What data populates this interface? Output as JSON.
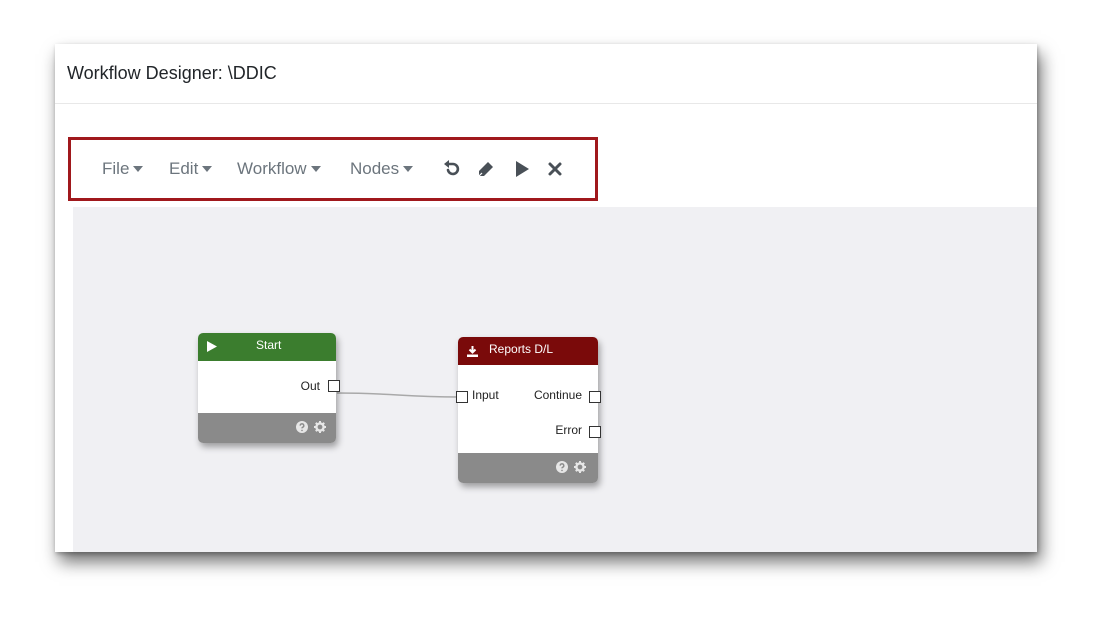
{
  "window": {
    "title": "Workflow Designer: \\DDIC"
  },
  "toolbar": {
    "menus": [
      {
        "label": "File"
      },
      {
        "label": "Edit"
      },
      {
        "label": "Workflow"
      },
      {
        "label": "Nodes"
      }
    ],
    "tools": [
      "undo-icon",
      "pencil-icon",
      "play-icon",
      "close-icon"
    ],
    "highlight_color": "#a0181c"
  },
  "canvas": {
    "background": "#f0f0f3",
    "nodes": [
      {
        "id": "start",
        "title": "Start",
        "header_icon": "play-icon",
        "header_color": "#3b7d2e",
        "inputs": [],
        "outputs": [
          {
            "label": "Out"
          }
        ],
        "footer_icons": [
          "help-icon",
          "gear-icon"
        ]
      },
      {
        "id": "reports",
        "title": "Reports D/L",
        "header_icon": "download-icon",
        "header_color": "#7a0a0a",
        "inputs": [
          {
            "label": "Input"
          }
        ],
        "outputs": [
          {
            "label": "Continue"
          },
          {
            "label": "Error"
          }
        ],
        "footer_icons": [
          "help-icon",
          "gear-icon"
        ]
      }
    ],
    "connections": [
      {
        "from": "start.Out",
        "to": "reports.Input"
      }
    ]
  }
}
